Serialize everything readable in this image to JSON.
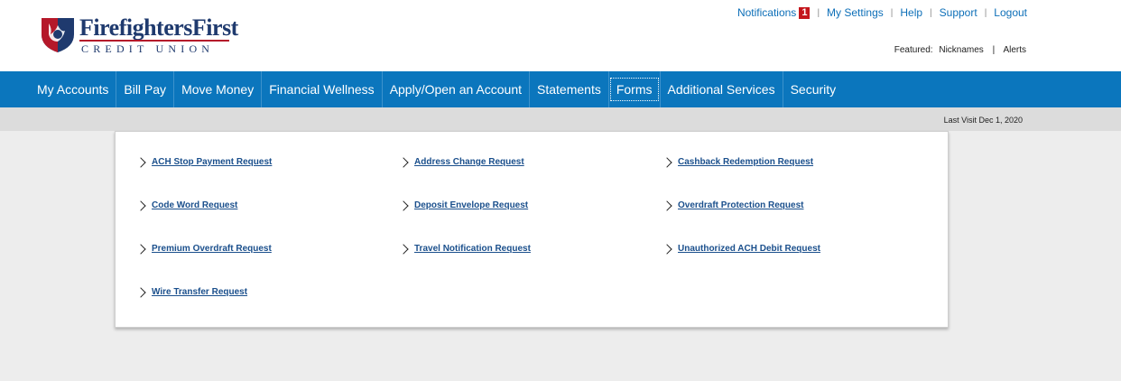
{
  "brand": {
    "name_part1": "Firefighters",
    "name_part2": "First",
    "subtitle": "CREDIT UNION",
    "colors": {
      "navy": "#1f3a6e",
      "red": "#b5182a"
    }
  },
  "util_links": {
    "notifications": "Notifications",
    "notifications_count": "1",
    "my_settings": "My Settings",
    "help": "Help",
    "support": "Support",
    "logout": "Logout"
  },
  "featured": {
    "label": "Featured:",
    "nicknames": "Nicknames",
    "separator": "|",
    "alerts": "Alerts"
  },
  "nav": {
    "items": [
      {
        "label": "My Accounts"
      },
      {
        "label": "Bill Pay"
      },
      {
        "label": "Move Money"
      },
      {
        "label": "Financial Wellness"
      },
      {
        "label": "Apply/Open an Account"
      },
      {
        "label": "Statements"
      },
      {
        "label": "Forms",
        "active": true
      },
      {
        "label": "Additional Services"
      },
      {
        "label": "Security"
      }
    ],
    "color": "#0b76bd"
  },
  "last_visit": "Last Visit Dec 1, 2020",
  "forms": {
    "links": [
      "ACH Stop Payment Request",
      "Address Change Request",
      "Cashback Redemption Request",
      "Code Word Request",
      "Deposit Envelope Request",
      "Overdraft Protection Request",
      "Premium Overdraft Request",
      "Travel Notification Request",
      "Unauthorized ACH Debit Request",
      "Wire Transfer Request"
    ]
  }
}
